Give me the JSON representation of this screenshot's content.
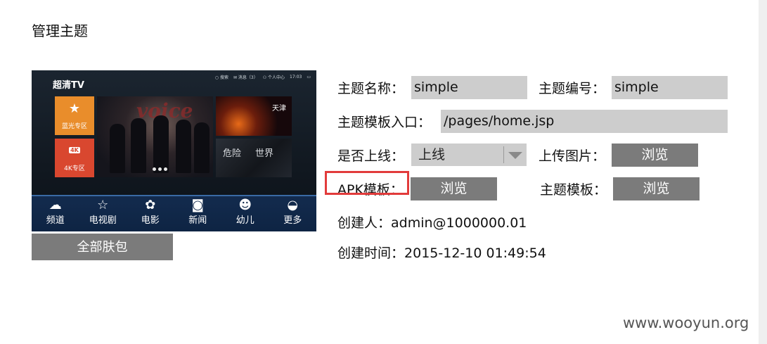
{
  "page": {
    "title": "管理主题"
  },
  "preview": {
    "logo": "超清TV",
    "status": {
      "search": "搜索",
      "messages": "消息（3）",
      "user_center": "个人中心",
      "time": "17:03"
    },
    "tiles": [
      {
        "label": "蓝光专区",
        "icon": "star-icon"
      },
      {
        "label": "4K专区",
        "badge": "4K"
      }
    ],
    "feature_text": "voice",
    "right_top_text": "天津",
    "right_bottom_text": [
      "危险",
      "世界"
    ],
    "nav": [
      {
        "label": "频道",
        "icon": "cloud-icon"
      },
      {
        "label": "电视剧",
        "icon": "star-outline-icon"
      },
      {
        "label": "电影",
        "icon": "film-reel-icon"
      },
      {
        "label": "新闻",
        "icon": "camera-icon"
      },
      {
        "label": "幼儿",
        "icon": "bear-icon"
      },
      {
        "label": "更多",
        "icon": "more-circle-icon"
      }
    ]
  },
  "all_skins_button": "全部肤包",
  "form": {
    "theme_name_label": "主题名称：",
    "theme_name_value": "simple",
    "theme_id_label": "主题编号：",
    "theme_id_value": "simple",
    "entry_label": "主题模板入口：",
    "entry_value": "/pages/home.jsp",
    "online_label": "是否上线：",
    "online_value": "上线",
    "upload_image_label": "上传图片：",
    "browse_label": "浏览",
    "apk_template_label": "APK模板：",
    "theme_template_label": "主题模板：",
    "creator_label": "创建人：",
    "creator_value": "admin@1000000.01",
    "created_time_label": "创建时间：",
    "created_time_value": "2015-12-10 01:49:54"
  },
  "watermark": "www.wooyun.org",
  "colors": {
    "button_gray": "#7b7b7b",
    "field_gray": "#cdcdcd",
    "highlight_red": "#e23b3b"
  }
}
